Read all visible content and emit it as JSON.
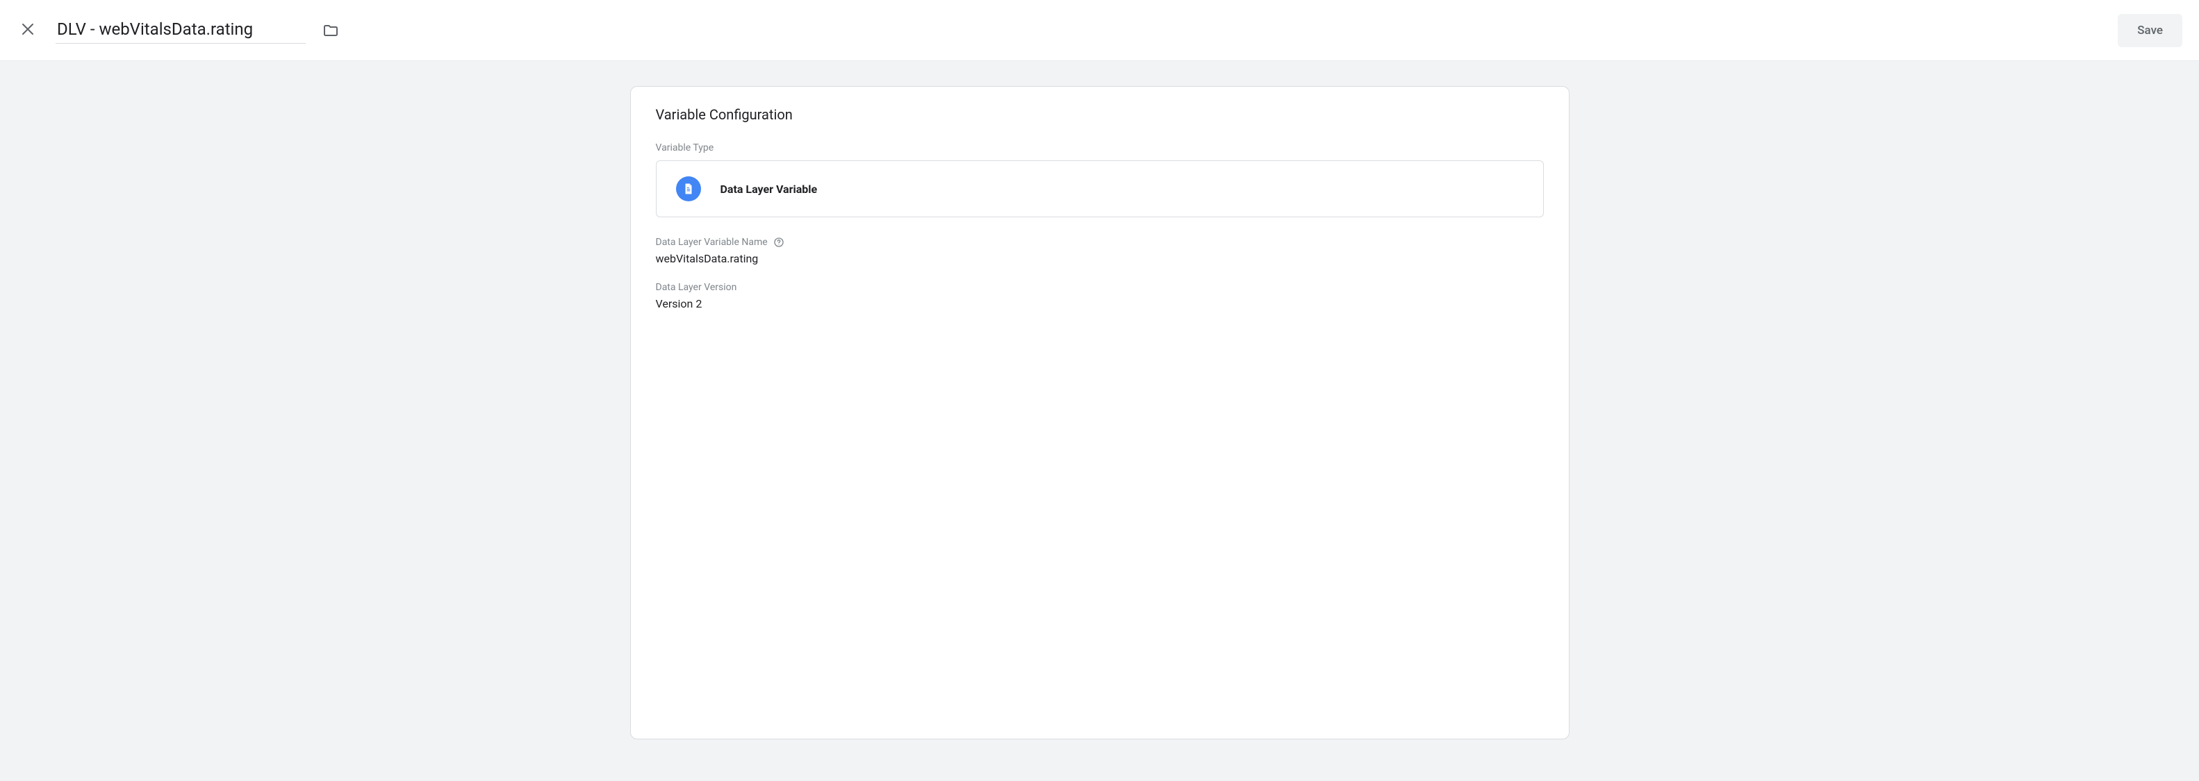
{
  "header": {
    "title": "DLV - webVitalsData.rating",
    "save_label": "Save"
  },
  "card": {
    "title": "Variable Configuration",
    "variable_type": {
      "label": "Variable Type",
      "value": "Data Layer Variable"
    },
    "variable_name": {
      "label": "Data Layer Variable Name",
      "value": "webVitalsData.rating"
    },
    "version": {
      "label": "Data Layer Version",
      "value": "Version 2"
    }
  }
}
